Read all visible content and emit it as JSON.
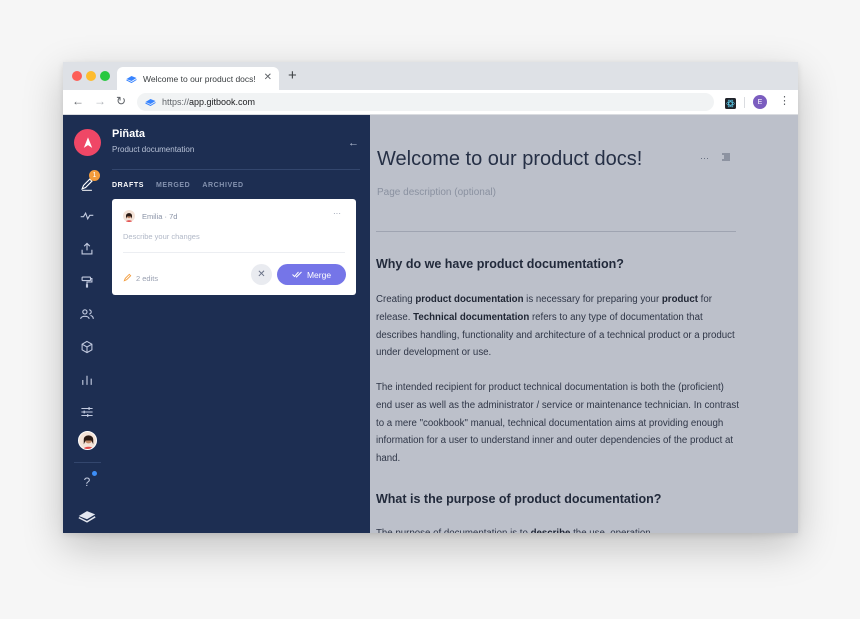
{
  "browser": {
    "tab_title": "Welcome to our product docs!",
    "url_protocol": "https://",
    "url_host": "app.gitbook.com",
    "profile_initial": "E"
  },
  "sidebar": {
    "space_name": "Piñata",
    "space_subtitle": "Product documentation",
    "drafts_badge": "1",
    "tabs": [
      {
        "label": "DRAFTS",
        "active": true
      },
      {
        "label": "MERGED",
        "active": false
      },
      {
        "label": "ARCHIVED",
        "active": false
      }
    ],
    "draft_card": {
      "author": "Emilia · 7d",
      "description_placeholder": "Describe your changes",
      "edits": "2 edits",
      "merge_label": "Merge"
    },
    "help_label": "?"
  },
  "page": {
    "title": "Welcome to our product docs!",
    "description_placeholder": "Page description (optional)",
    "heading_1": "Why do we have product documentation?",
    "p1": [
      {
        "text": "Creating ",
        "bold": false
      },
      {
        "text": "product documentation",
        "bold": true
      },
      {
        "text": " is necessary for preparing your ",
        "bold": false
      },
      {
        "text": "product",
        "bold": true
      },
      {
        "text": " for release. ",
        "bold": false
      },
      {
        "text": "Technical documentation",
        "bold": true
      },
      {
        "text": " refers to any type of documentation that describes handling, functionality and architecture of a technical product or a product under development or use.",
        "bold": false
      }
    ],
    "p2": "The intended recipient for product technical documentation is both the (proficient) end user as well as the administrator / service or maintenance technician. In contrast to a mere \"cookbook\" manual, technical documentation aims at providing enough information for a user to understand inner and outer dependencies of the product at hand.",
    "heading_2": "What is the purpose of product documentation?",
    "p3_partial": [
      {
        "text": "The purpose of documentation is to ",
        "bold": false
      },
      {
        "text": "describe",
        "bold": true
      },
      {
        "text": " the use, operation",
        "bold": false
      }
    ]
  },
  "colors": {
    "sidebar_bg": "#1d2e52",
    "accent": "#7575e8",
    "logo": "#ef4766",
    "badge": "#f39c3c",
    "content_overlay": "#bcc0ca"
  }
}
